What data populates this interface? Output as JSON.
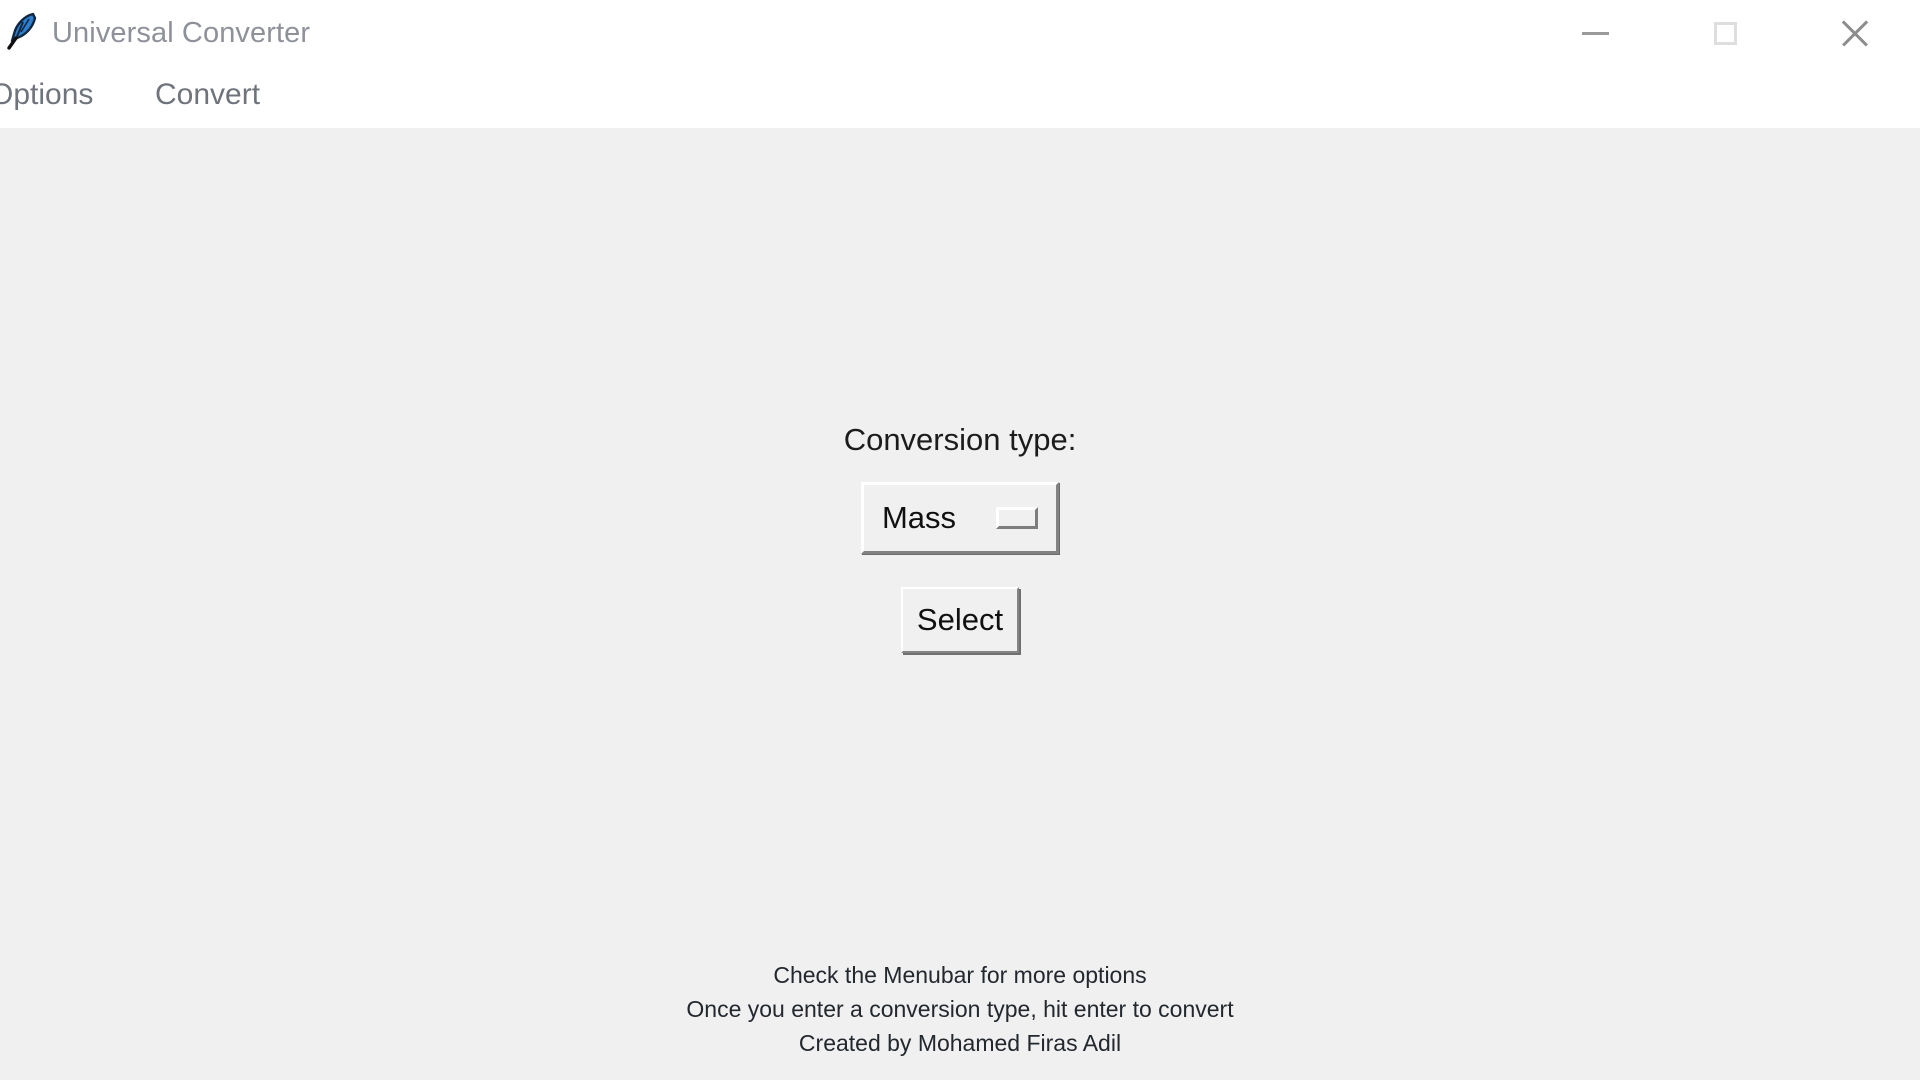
{
  "window": {
    "title": "Universal Converter",
    "icon": "feather-icon",
    "controls": {
      "minimize": "minimize-icon",
      "maximize": "maximize-icon",
      "close": "close-icon"
    },
    "colors": {
      "titlebar_bg": "#ffffff",
      "title_text": "#8e9199",
      "menubar_bg": "#ffffff",
      "menu_text": "#6f737c",
      "content_bg": "#f0f0f0",
      "body_text": "#1c1c1c",
      "control_face": "#f0f0f0"
    }
  },
  "menubar": {
    "items": [
      {
        "label": "Options"
      },
      {
        "label": "Convert"
      }
    ]
  },
  "main": {
    "conversion_label": "Conversion type:",
    "conversion_type": {
      "selected": "Mass",
      "options": [
        "Mass"
      ],
      "indicator": "option-menu-indicator"
    },
    "select_button": "Select"
  },
  "footer": {
    "notes": [
      "Check the Menubar for more options",
      "Once you enter a conversion type, hit enter to convert",
      "Created by Mohamed Firas Adil"
    ]
  }
}
